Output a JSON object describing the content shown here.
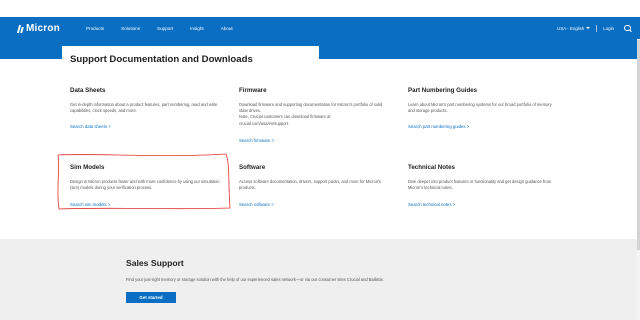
{
  "nav": {
    "logo": "Micron",
    "links": [
      "Products",
      "Solutions",
      "Support",
      "Insight",
      "About"
    ],
    "region": "USA - English",
    "login": "Login"
  },
  "page_title": "Support Documentation and Downloads",
  "cards": [
    {
      "title": "Data Sheets",
      "desc": "Get in-depth information about a product features, part numbering, read and write capabilities, clock speeds, and more.",
      "link": "Search data sheets >"
    },
    {
      "title": "Firmware",
      "desc": "Download firmware and supporting documentation for Micron's portfolio of solid state drives.",
      "note": "Note, Crucial customers can download firmware at crucial.com/usa/en/support.",
      "link": "Search firmware >"
    },
    {
      "title": "Part Numbering Guides",
      "desc": "Learn about Micron's part numbering systems for our broad portfolio of memory and storage products.",
      "link": "Search part numbering guides >"
    },
    {
      "title": "Sim Models",
      "desc": "Design in Micron products faster and with more confidence by using our simulation (sim) models during your verification process.",
      "link": "Search sim models >"
    },
    {
      "title": "Software",
      "desc": "Access software documentation, drivers, support packs, and more for Micron's products.",
      "link": "Search software >"
    },
    {
      "title": "Technical Notes",
      "desc": "Dive deeper into product features or functionality and get design guidance from Micron's technical notes.",
      "link": "Search technical notes >"
    }
  ],
  "sales": {
    "title": "Sales Support",
    "desc": "Find your just-right memory or storage solution with the help of our experienced sales network—or via our consumer sites Crucial and Ballistix.",
    "button": "Get started"
  },
  "colors": {
    "brand_blue": "#0a6fc2",
    "annotation_red": "#e0312f"
  }
}
